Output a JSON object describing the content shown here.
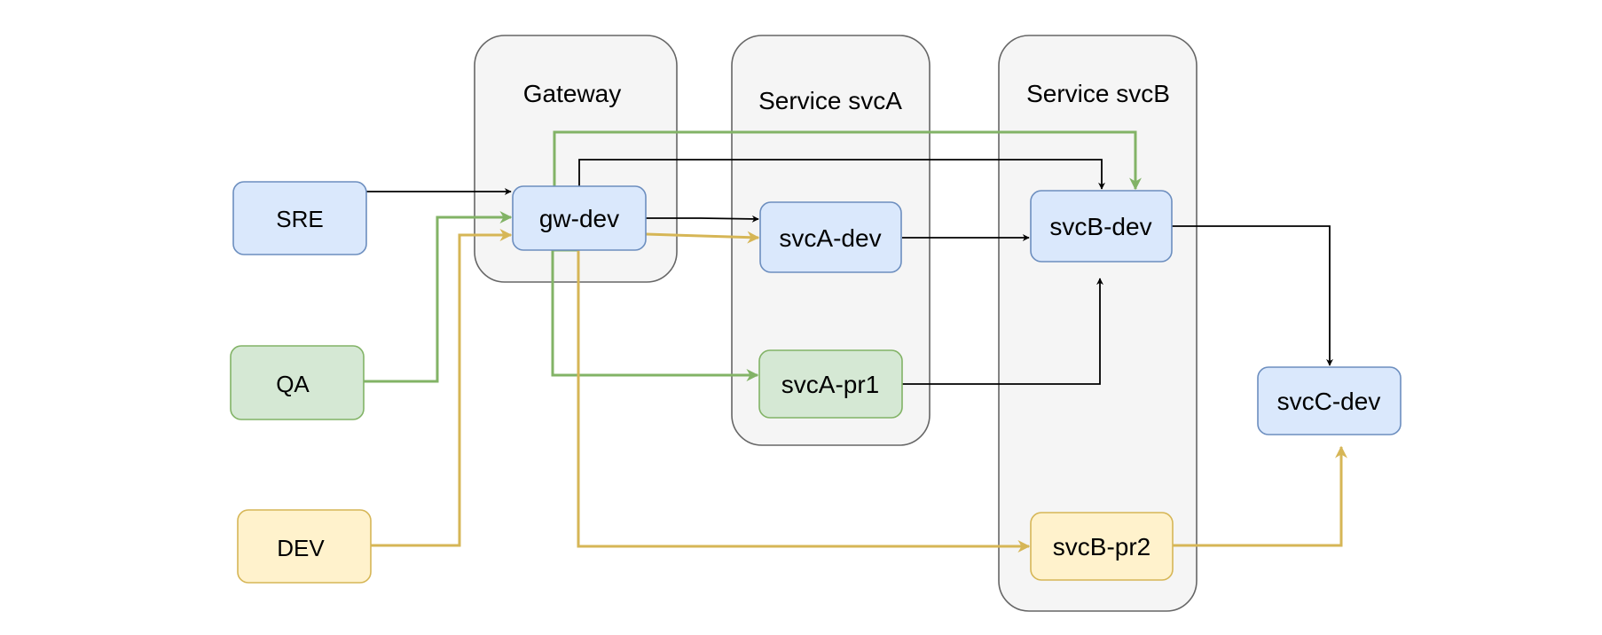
{
  "diagram": {
    "colors": {
      "blue_fill": "#dae8fc",
      "blue_stroke": "#6c8ebf",
      "green_fill": "#d5e8d4",
      "green_stroke": "#82b366",
      "yellow_fill": "#fff2cc",
      "yellow_stroke": "#d6b656",
      "black": "#000000",
      "container_fill": "#f5f5f5",
      "container_stroke": "#666666"
    },
    "containers": {
      "gateway": {
        "label": "Gateway"
      },
      "svcA": {
        "label": "Service svcA"
      },
      "svcB": {
        "label": "Service svcB"
      }
    },
    "nodes": {
      "sre": {
        "label": "SRE",
        "color": "blue"
      },
      "qa": {
        "label": "QA",
        "color": "green"
      },
      "dev": {
        "label": "DEV",
        "color": "yellow"
      },
      "gw_dev": {
        "label": "gw-dev",
        "color": "blue"
      },
      "svcA_dev": {
        "label": "svcA-dev",
        "color": "blue"
      },
      "svcA_pr1": {
        "label": "svcA-pr1",
        "color": "green"
      },
      "svcB_dev": {
        "label": "svcB-dev",
        "color": "blue"
      },
      "svcB_pr2": {
        "label": "svcB-pr2",
        "color": "yellow"
      },
      "svcC_dev": {
        "label": "svcC-dev",
        "color": "blue"
      }
    },
    "edges": [
      {
        "from": "SRE",
        "to": "gw-dev",
        "color": "black"
      },
      {
        "from": "QA",
        "to": "gw-dev",
        "color": "green"
      },
      {
        "from": "DEV",
        "to": "gw-dev",
        "color": "yellow"
      },
      {
        "from": "gw-dev",
        "to": "svcA-dev",
        "color": "black"
      },
      {
        "from": "gw-dev",
        "to": "svcA-dev",
        "color": "yellow"
      },
      {
        "from": "gw-dev",
        "to": "svcB-dev",
        "color": "black"
      },
      {
        "from": "gw-dev",
        "to": "svcB-dev",
        "color": "green"
      },
      {
        "from": "gw-dev",
        "to": "svcA-pr1",
        "color": "green"
      },
      {
        "from": "gw-dev",
        "to": "svcB-pr2",
        "color": "yellow"
      },
      {
        "from": "svcA-dev",
        "to": "svcB-dev",
        "color": "black"
      },
      {
        "from": "svcA-pr1",
        "to": "svcB-dev",
        "color": "black"
      },
      {
        "from": "svcB-dev",
        "to": "svcC-dev",
        "color": "black"
      },
      {
        "from": "svcB-pr2",
        "to": "svcC-dev",
        "color": "yellow"
      }
    ]
  }
}
